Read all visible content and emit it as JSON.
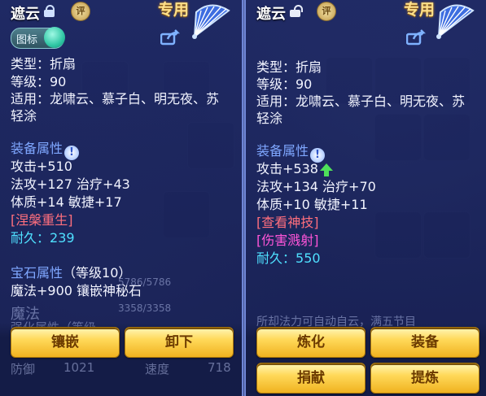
{
  "left_panel": {
    "title": "遮云",
    "badge": "评",
    "exclusive_label": "专用",
    "icon_toggle_label": "图标",
    "type_line": "类型：折扇",
    "level_line": "等级：90",
    "suitable_line1": "适用：龙啸云、慕子白、明无夜、苏",
    "suitable_line2": "轻涂",
    "equip_attr_title": "装备属性",
    "attack": "攻击+510",
    "magic_heal": "法攻+127 治疗+43",
    "body_agility": "体质+14 敏捷+17",
    "special_skill": "[涅槃重生]",
    "durability_label": "耐久：",
    "durability_value": "239",
    "gem_title": "宝石属性",
    "gem_level": "（等级10）",
    "gem_line": "魔法+900 镶嵌神秘石",
    "faded_line1": "魔法",
    "faded_value1": "3358/3358",
    "faded_value2": "5786/5786",
    "faded_line2": "强化属性（等级",
    "faded_bottom_label": "防御",
    "faded_bottom_value": "1021",
    "faded_bottom_speed": "速度",
    "faded_bottom_speed_value": "718",
    "buttons": [
      "镶嵌",
      "卸下"
    ]
  },
  "right_panel": {
    "title": "遮云",
    "badge": "评",
    "exclusive_label": "专用",
    "type_line": "类型：折扇",
    "level_line": "等级：90",
    "suitable_line1": "适用：龙啸云、慕子白、明无夜、苏",
    "suitable_line2": "轻涂",
    "equip_attr_title": "装备属性",
    "attack": "攻击+538",
    "magic_heal": "法攻+134 治疗+70",
    "body_agility": "体质+10 敏捷+11",
    "skill1": "[查看神技]",
    "skill2": "[伤害溅射]",
    "durability_label": "耐久：",
    "durability_value": "550",
    "faded_line": "所却法力可自动自云，满五节目",
    "buttons": [
      "炼化",
      "装备",
      "捐献",
      "提炼"
    ]
  },
  "colors": {
    "gold_text": "#ffe08a",
    "section_blue": "#7fa7ff",
    "cyan": "#4fe0ff",
    "red_skill": "#ff6f7d",
    "magenta_skill": "#ff55d8",
    "button_gold": "#ffd95a"
  },
  "icons": [
    "lock-locked-icon",
    "lock-unlocked-icon",
    "rating-badge-icon",
    "fan-weapon-icon",
    "share-icon",
    "info-icon",
    "up-arrow-icon"
  ]
}
